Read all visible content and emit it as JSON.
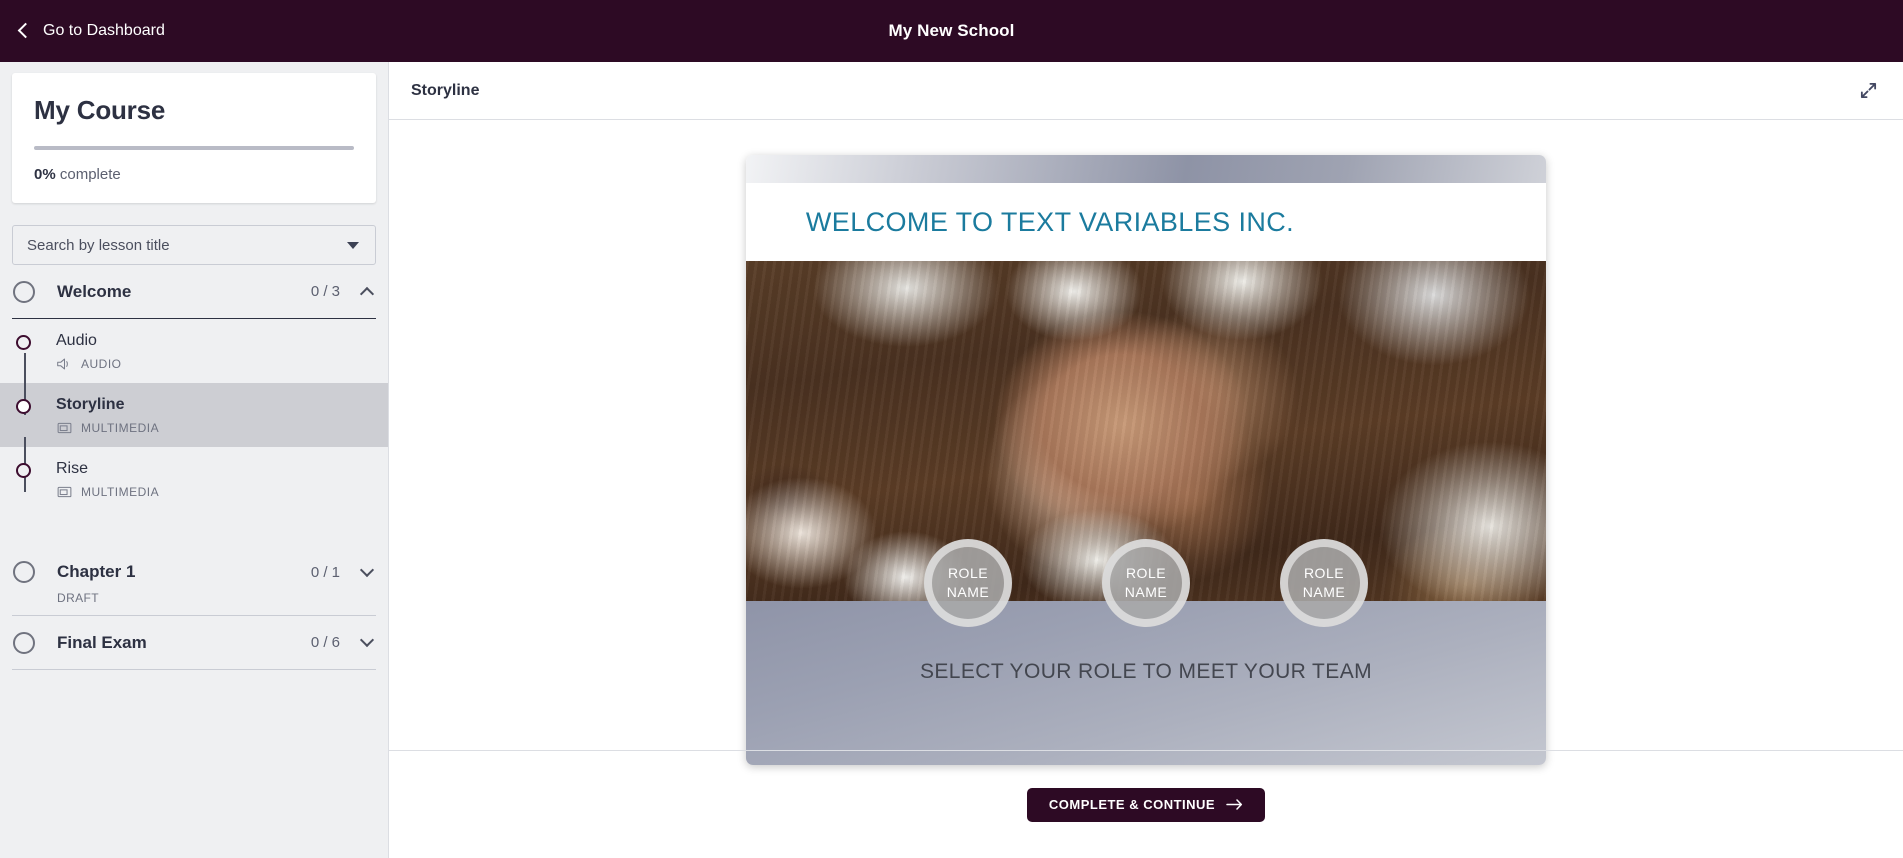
{
  "header": {
    "back_label": "Go to Dashboard",
    "school_title": "My New School",
    "back_icon": "chevron-left-icon",
    "bg_color": "#2d0a24"
  },
  "sidebar": {
    "course_title": "My Course",
    "progress_percent": "0%",
    "progress_suffix": " complete",
    "progress_value": 0,
    "search_placeholder": "Search by lesson title",
    "search_value": "",
    "dropdown_icon": "caret-down-icon",
    "sections": [
      {
        "name": "Welcome",
        "count": "0 / 3",
        "expanded": true,
        "chevron": "chevron-up-icon",
        "sublabel": "",
        "lessons": [
          {
            "name": "Audio",
            "type": "AUDIO",
            "icon": "speaker-icon",
            "active": false
          },
          {
            "name": "Storyline",
            "type": "MULTIMEDIA",
            "icon": "multimedia-icon",
            "active": true
          },
          {
            "name": "Rise",
            "type": "MULTIMEDIA",
            "icon": "multimedia-icon",
            "active": false
          }
        ]
      },
      {
        "name": "Chapter 1",
        "count": "0 / 1",
        "expanded": false,
        "chevron": "chevron-down-icon",
        "sublabel": "DRAFT",
        "lessons": []
      },
      {
        "name": "Final Exam",
        "count": "0 / 6",
        "expanded": false,
        "chevron": "chevron-down-icon",
        "sublabel": "",
        "lessons": []
      }
    ]
  },
  "main": {
    "lesson_title": "Storyline",
    "expand_icon": "expand-fullscreen-icon",
    "slide": {
      "title": "WELCOME TO TEXT VARIABLES INC.",
      "title_color": "#1b7b9e",
      "prompt": "SELECT YOUR ROLE TO MEET YOUR TEAM",
      "roles": [
        {
          "line1": "ROLE",
          "line2": "NAME"
        },
        {
          "line1": "ROLE",
          "line2": "NAME"
        },
        {
          "line1": "ROLE",
          "line2": "NAME"
        }
      ],
      "photo_alt": "four-fists-bumping-over-desk-photo"
    },
    "continue_label": "COMPLETE & CONTINUE",
    "continue_arrow": "arrow-right-icon"
  }
}
